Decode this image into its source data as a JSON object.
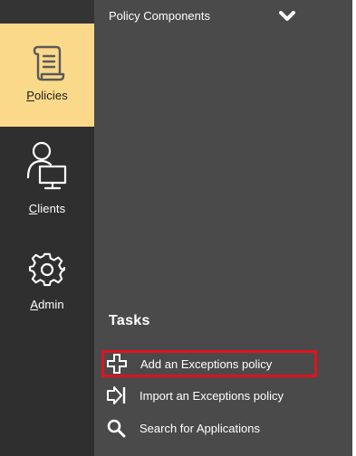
{
  "nav": {
    "items": [
      {
        "id": "policies",
        "label_prefix": "",
        "label_accel": "P",
        "label_rest": "olicies",
        "icon": "scroll-icon",
        "active": true
      },
      {
        "id": "clients",
        "label_prefix": "",
        "label_accel": "C",
        "label_rest": "lients",
        "icon": "user-computer-icon",
        "active": false
      },
      {
        "id": "admin",
        "label_prefix": "",
        "label_accel": "A",
        "label_rest": "dmin",
        "icon": "gear-icon",
        "active": false
      }
    ]
  },
  "panel": {
    "section_header": "Policy Components",
    "section_icon": "chevron-down-icon",
    "tasks_title": "Tasks",
    "tasks": [
      {
        "label": "Add an Exceptions policy",
        "icon": "plus-icon",
        "highlighted": true
      },
      {
        "label": "Import an Exceptions policy",
        "icon": "import-arrow-icon",
        "highlighted": false
      },
      {
        "label": "Search for Applications",
        "icon": "search-icon",
        "highlighted": false
      }
    ]
  },
  "colors": {
    "rail_bg": "#2f2f2f",
    "panel_bg": "#4a4a4a",
    "active_bg": "#fbd98a",
    "highlight_border": "#e0121f",
    "text": "#ffffff"
  }
}
